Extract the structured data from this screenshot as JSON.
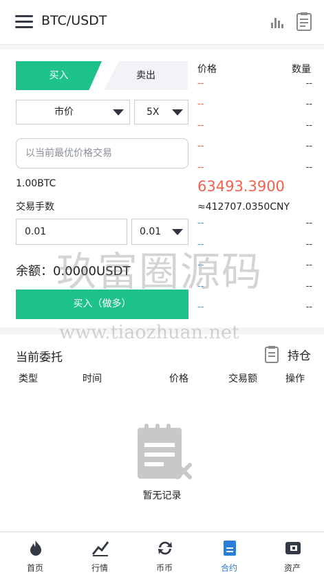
{
  "header": {
    "title": "BTC/USDT",
    "menu_icon": "menu-icon",
    "chart_icon": "bar-chart-icon",
    "doc_icon": "clipboard-icon"
  },
  "trade": {
    "tab_buy": "买入",
    "tab_sell": "卖出",
    "order_type": "市价",
    "leverage": "5X",
    "price_placeholder": "以当前最优价格交易",
    "amount_text": "1.00BTC",
    "fee_label": "交易手数",
    "quantity_value": "0.01",
    "quantity_select": "0.01",
    "balance": "余额：0.0000USDT",
    "buy_button": "买入（做多）"
  },
  "orderbook": {
    "price_header": "价格",
    "qty_header": "数量",
    "asks": [
      {
        "price": "--",
        "qty": "--"
      },
      {
        "price": "--",
        "qty": "--"
      },
      {
        "price": "--",
        "qty": "--"
      },
      {
        "price": "--",
        "qty": "--"
      },
      {
        "price": "--",
        "qty": "--"
      }
    ],
    "last_price": "63493.3900",
    "cny_price": "≈412707.0350CNY",
    "bids": [
      {
        "price": "--",
        "qty": "--"
      },
      {
        "price": "--",
        "qty": "--"
      },
      {
        "price": "--",
        "qty": "--"
      },
      {
        "price": "--",
        "qty": "--"
      },
      {
        "price": "--",
        "qty": "--"
      }
    ],
    "ask_color": "#e8604c",
    "bid_color": "#3b9cc4"
  },
  "orders": {
    "title": "当前委托",
    "positions_label": "持仓",
    "columns": [
      "类型",
      "时间",
      "价格",
      "交易额",
      "操作"
    ],
    "empty_text": "暂无记录"
  },
  "tabbar": [
    {
      "label": "首页",
      "icon": "flame-icon"
    },
    {
      "label": "行情",
      "icon": "market-icon"
    },
    {
      "label": "币币",
      "icon": "exchange-icon"
    },
    {
      "label": "合约",
      "icon": "contract-icon",
      "active": true
    },
    {
      "label": "资产",
      "icon": "wallet-icon"
    }
  ],
  "watermark": {
    "cn": "玖富圈源码",
    "url": "www.tiaozhuan.net"
  },
  "colors": {
    "accent": "#1dc28b",
    "active_tab": "#2a7fd8",
    "price_up": "#f0624d"
  }
}
